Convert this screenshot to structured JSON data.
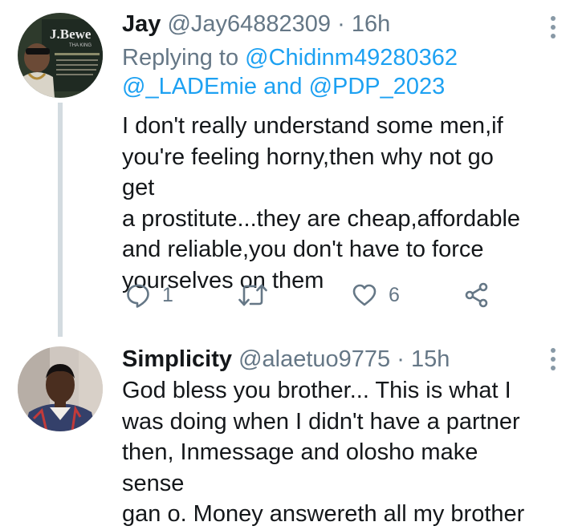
{
  "tweets": [
    {
      "author_name": "Jay",
      "handle": "@Jay64882309",
      "separator": "·",
      "time": "16h",
      "replying_prefix": "Replying to",
      "mention_1": "@Chidinm49280362",
      "mention_2": "@_LADEmie",
      "mention_joiner": "and",
      "mention_3": "@PDP_2023",
      "text": "I don't really understand some men,if\nyou're feeling horny,then why not go get\na prostitute...they are cheap,affordable\nand reliable,you don't have to force\nyourselves on them",
      "avatar_sign_text": "J.Bewe",
      "avatar_sign_sub": "THA KING",
      "reply_count": "1",
      "like_count": "6",
      "icons": [
        "reply-icon",
        "retweet-icon",
        "like-icon",
        "share-icon",
        "more-options-icon"
      ]
    },
    {
      "author_name": "Simplicity",
      "handle": "@alaetuo9775",
      "separator": "·",
      "time": "15h",
      "text": "God bless you brother... This is what I\nwas doing when I didn't have a partner\nthen, Inmessage and olosho make sense\ngan o. Money answereth all my brother",
      "icons": [
        "more-options-icon"
      ]
    }
  ],
  "colors": {
    "text": "#14171a",
    "secondary": "#657786",
    "link": "#1da1f2",
    "thread_line": "#d3dbe0"
  }
}
